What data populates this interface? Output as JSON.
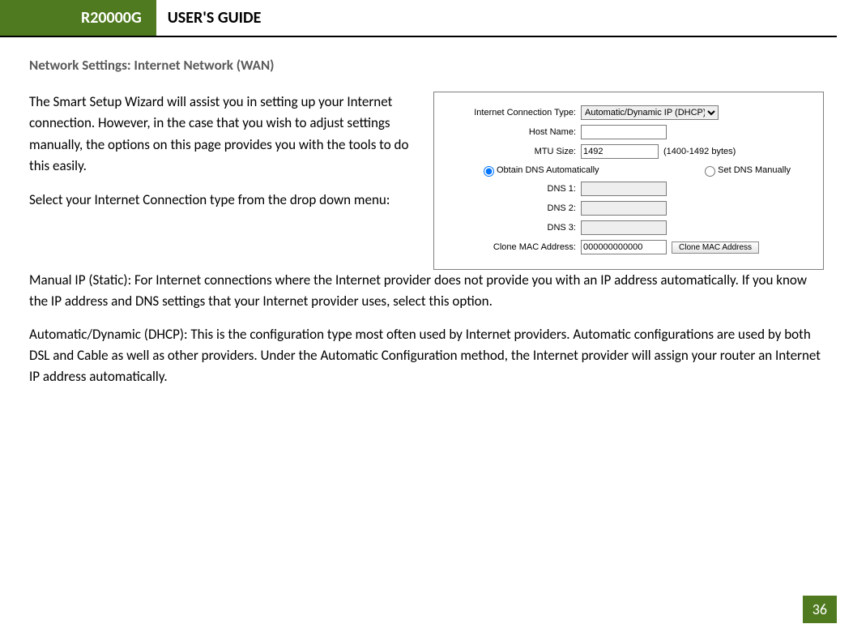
{
  "header": {
    "model": "R20000G",
    "title": "USER'S GUIDE"
  },
  "section_title": "Network Settings: Internet Network (WAN)",
  "intro": {
    "p1": "The Smart Setup Wizard will assist you in setting up your Internet connection.  However, in the case that you wish to adjust settings manually, the options on this page provides you with the tools to do this easily.",
    "p2": "Select your Internet Connection type from the drop down menu:"
  },
  "panel": {
    "labels": {
      "conn_type": "Internet Connection Type:",
      "host_name": "Host Name:",
      "mtu": "MTU Size:",
      "mtu_note": "(1400-1492 bytes)",
      "obtain_dns": "Obtain DNS Automatically",
      "set_dns": "Set DNS Manually",
      "dns1": "DNS 1:",
      "dns2": "DNS 2:",
      "dns3": "DNS 3:",
      "clone_mac": "Clone MAC Address:",
      "clone_btn": "Clone MAC Address"
    },
    "values": {
      "conn_type_selected": "Automatic/Dynamic IP (DHCP)",
      "host_name": "",
      "mtu": "1492",
      "dns1": "",
      "dns2": "",
      "dns3": "",
      "clone_mac": "000000000000"
    }
  },
  "body": {
    "p1": "Manual IP (Static): For Internet connections where the Internet provider does not provide you with an IP address automatically.  If you know the IP address and DNS settings that your Internet provider uses, select this option.",
    "p2": "Automatic/Dynamic (DHCP): This is the configuration type most often used by Internet providers.  Automatic configurations are used by both DSL and Cable as well as other providers.  Under the Automatic Configuration method, the Internet provider will assign your router an Internet IP address automatically."
  },
  "page_number": "36"
}
